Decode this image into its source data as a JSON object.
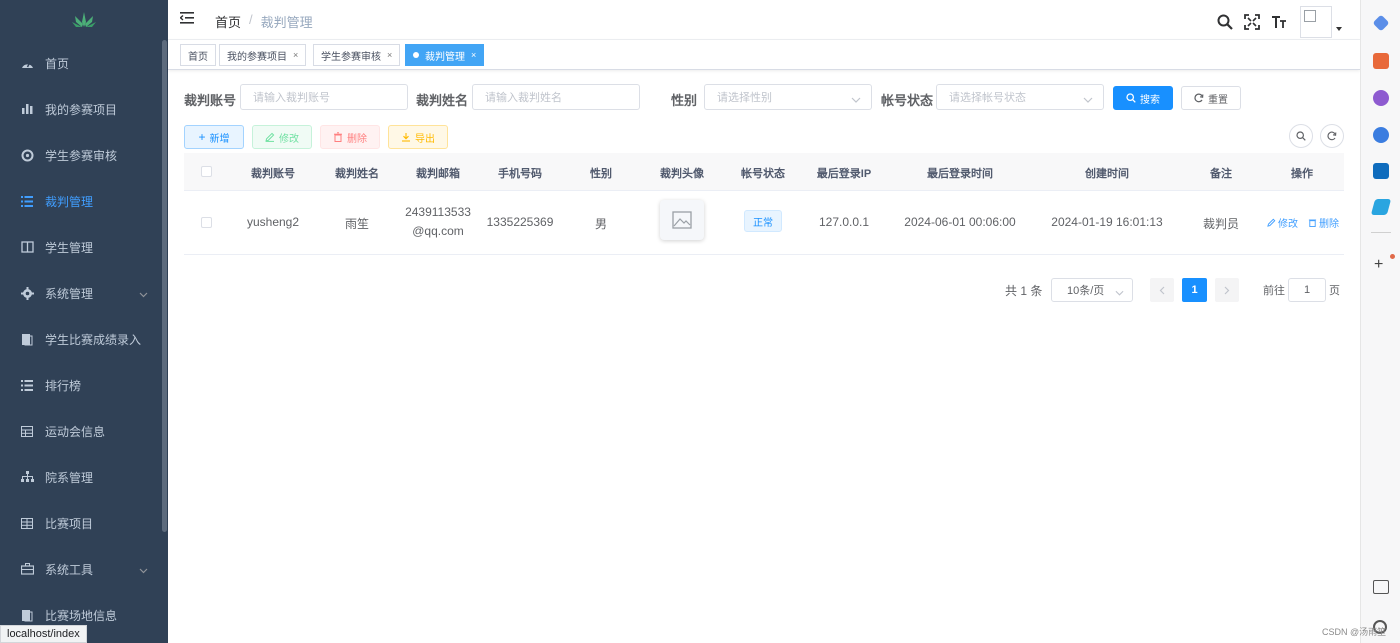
{
  "sidebar": {
    "items": [
      {
        "label": "首页",
        "icon": "dashboard-icon"
      },
      {
        "label": "我的参赛项目",
        "icon": "bar-chart-icon"
      },
      {
        "label": "学生参赛审核",
        "icon": "settings-icon"
      },
      {
        "label": "裁判管理",
        "icon": "list-icon",
        "active": true
      },
      {
        "label": "学生管理",
        "icon": "book-icon"
      },
      {
        "label": "系统管理",
        "icon": "gear-icon",
        "expandable": true
      },
      {
        "label": "学生比赛成绩录入",
        "icon": "document-icon"
      },
      {
        "label": "排行榜",
        "icon": "ranking-list-icon"
      },
      {
        "label": "运动会信息",
        "icon": "table-icon"
      },
      {
        "label": "院系管理",
        "icon": "tree-icon"
      },
      {
        "label": "比赛项目",
        "icon": "grid-icon"
      },
      {
        "label": "系统工具",
        "icon": "toolbox-icon",
        "expandable": true
      },
      {
        "label": "比赛场地信息",
        "icon": "venue-icon"
      }
    ],
    "accent": "#409eff",
    "bg": "#304156"
  },
  "navbar": {
    "breadcrumb_home": "首页",
    "breadcrumb_sep": "/",
    "breadcrumb_current": "裁判管理"
  },
  "tags": [
    {
      "label": "首页",
      "closable": false
    },
    {
      "label": "我的参赛项目",
      "closable": true
    },
    {
      "label": "学生参赛审核",
      "closable": true
    },
    {
      "label": "裁判管理",
      "closable": true,
      "active": true
    }
  ],
  "search": {
    "account_label": "裁判账号",
    "account_placeholder": "请输入裁判账号",
    "name_label": "裁判姓名",
    "name_placeholder": "请输入裁判姓名",
    "gender_label": "性别",
    "gender_placeholder": "请选择性别",
    "status_label": "帐号状态",
    "status_placeholder": "请选择帐号状态",
    "search_btn": "搜索",
    "reset_btn": "重置"
  },
  "toolbar": {
    "add": "新增",
    "edit": "修改",
    "delete": "删除",
    "export": "导出"
  },
  "table": {
    "headers": [
      "裁判账号",
      "裁判姓名",
      "裁判邮箱",
      "手机号码",
      "性别",
      "裁判头像",
      "帐号状态",
      "最后登录IP",
      "最后登录时间",
      "创建时间",
      "备注",
      "操作"
    ],
    "rows": [
      {
        "account": "yusheng2",
        "name": "雨笙",
        "email_line1": "2439113533",
        "email_line2": "@qq.com",
        "phone": "1335225369",
        "gender": "男",
        "status": "正常",
        "ip": "127.0.0.1",
        "last_login": "2024-06-01 00:06:00",
        "created": "2024-01-19 16:01:13",
        "remark": "裁判员",
        "op_edit": "修改",
        "op_delete": "删除"
      }
    ]
  },
  "pagination": {
    "total": "共 1 条",
    "page_size": "10条/页",
    "current_page": "1",
    "goto_prefix": "前往",
    "goto_value": "1",
    "goto_suffix": "页"
  },
  "statusbar": {
    "url": "localhost/index"
  },
  "watermark": "CSDN @汤雨笙"
}
